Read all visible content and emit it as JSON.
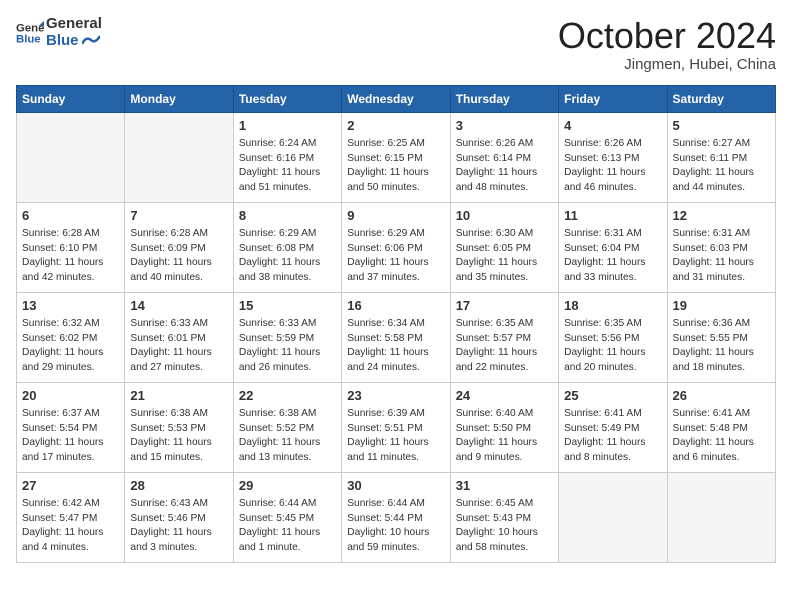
{
  "header": {
    "logo_line1": "General",
    "logo_line2": "Blue",
    "month": "October 2024",
    "location": "Jingmen, Hubei, China"
  },
  "weekdays": [
    "Sunday",
    "Monday",
    "Tuesday",
    "Wednesday",
    "Thursday",
    "Friday",
    "Saturday"
  ],
  "weeks": [
    [
      {
        "day": "",
        "info": ""
      },
      {
        "day": "",
        "info": ""
      },
      {
        "day": "1",
        "info": "Sunrise: 6:24 AM\nSunset: 6:16 PM\nDaylight: 11 hours and 51 minutes."
      },
      {
        "day": "2",
        "info": "Sunrise: 6:25 AM\nSunset: 6:15 PM\nDaylight: 11 hours and 50 minutes."
      },
      {
        "day": "3",
        "info": "Sunrise: 6:26 AM\nSunset: 6:14 PM\nDaylight: 11 hours and 48 minutes."
      },
      {
        "day": "4",
        "info": "Sunrise: 6:26 AM\nSunset: 6:13 PM\nDaylight: 11 hours and 46 minutes."
      },
      {
        "day": "5",
        "info": "Sunrise: 6:27 AM\nSunset: 6:11 PM\nDaylight: 11 hours and 44 minutes."
      }
    ],
    [
      {
        "day": "6",
        "info": "Sunrise: 6:28 AM\nSunset: 6:10 PM\nDaylight: 11 hours and 42 minutes."
      },
      {
        "day": "7",
        "info": "Sunrise: 6:28 AM\nSunset: 6:09 PM\nDaylight: 11 hours and 40 minutes."
      },
      {
        "day": "8",
        "info": "Sunrise: 6:29 AM\nSunset: 6:08 PM\nDaylight: 11 hours and 38 minutes."
      },
      {
        "day": "9",
        "info": "Sunrise: 6:29 AM\nSunset: 6:06 PM\nDaylight: 11 hours and 37 minutes."
      },
      {
        "day": "10",
        "info": "Sunrise: 6:30 AM\nSunset: 6:05 PM\nDaylight: 11 hours and 35 minutes."
      },
      {
        "day": "11",
        "info": "Sunrise: 6:31 AM\nSunset: 6:04 PM\nDaylight: 11 hours and 33 minutes."
      },
      {
        "day": "12",
        "info": "Sunrise: 6:31 AM\nSunset: 6:03 PM\nDaylight: 11 hours and 31 minutes."
      }
    ],
    [
      {
        "day": "13",
        "info": "Sunrise: 6:32 AM\nSunset: 6:02 PM\nDaylight: 11 hours and 29 minutes."
      },
      {
        "day": "14",
        "info": "Sunrise: 6:33 AM\nSunset: 6:01 PM\nDaylight: 11 hours and 27 minutes."
      },
      {
        "day": "15",
        "info": "Sunrise: 6:33 AM\nSunset: 5:59 PM\nDaylight: 11 hours and 26 minutes."
      },
      {
        "day": "16",
        "info": "Sunrise: 6:34 AM\nSunset: 5:58 PM\nDaylight: 11 hours and 24 minutes."
      },
      {
        "day": "17",
        "info": "Sunrise: 6:35 AM\nSunset: 5:57 PM\nDaylight: 11 hours and 22 minutes."
      },
      {
        "day": "18",
        "info": "Sunrise: 6:35 AM\nSunset: 5:56 PM\nDaylight: 11 hours and 20 minutes."
      },
      {
        "day": "19",
        "info": "Sunrise: 6:36 AM\nSunset: 5:55 PM\nDaylight: 11 hours and 18 minutes."
      }
    ],
    [
      {
        "day": "20",
        "info": "Sunrise: 6:37 AM\nSunset: 5:54 PM\nDaylight: 11 hours and 17 minutes."
      },
      {
        "day": "21",
        "info": "Sunrise: 6:38 AM\nSunset: 5:53 PM\nDaylight: 11 hours and 15 minutes."
      },
      {
        "day": "22",
        "info": "Sunrise: 6:38 AM\nSunset: 5:52 PM\nDaylight: 11 hours and 13 minutes."
      },
      {
        "day": "23",
        "info": "Sunrise: 6:39 AM\nSunset: 5:51 PM\nDaylight: 11 hours and 11 minutes."
      },
      {
        "day": "24",
        "info": "Sunrise: 6:40 AM\nSunset: 5:50 PM\nDaylight: 11 hours and 9 minutes."
      },
      {
        "day": "25",
        "info": "Sunrise: 6:41 AM\nSunset: 5:49 PM\nDaylight: 11 hours and 8 minutes."
      },
      {
        "day": "26",
        "info": "Sunrise: 6:41 AM\nSunset: 5:48 PM\nDaylight: 11 hours and 6 minutes."
      }
    ],
    [
      {
        "day": "27",
        "info": "Sunrise: 6:42 AM\nSunset: 5:47 PM\nDaylight: 11 hours and 4 minutes."
      },
      {
        "day": "28",
        "info": "Sunrise: 6:43 AM\nSunset: 5:46 PM\nDaylight: 11 hours and 3 minutes."
      },
      {
        "day": "29",
        "info": "Sunrise: 6:44 AM\nSunset: 5:45 PM\nDaylight: 11 hours and 1 minute."
      },
      {
        "day": "30",
        "info": "Sunrise: 6:44 AM\nSunset: 5:44 PM\nDaylight: 10 hours and 59 minutes."
      },
      {
        "day": "31",
        "info": "Sunrise: 6:45 AM\nSunset: 5:43 PM\nDaylight: 10 hours and 58 minutes."
      },
      {
        "day": "",
        "info": ""
      },
      {
        "day": "",
        "info": ""
      }
    ]
  ]
}
